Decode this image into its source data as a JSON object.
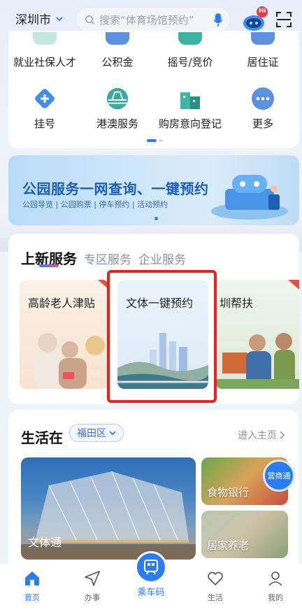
{
  "header": {
    "city": "深圳市",
    "search_placeholder": "搜索“体育场馆预约”",
    "robot_badge": "Hi"
  },
  "services": [
    {
      "label": "就业社保人才",
      "icon": "briefcase-icon"
    },
    {
      "label": "公积金",
      "icon": "fund-icon"
    },
    {
      "label": "摇号/竞价",
      "icon": "car-icon"
    },
    {
      "label": "居住证",
      "icon": "id-card-icon"
    },
    {
      "label": "挂号",
      "icon": "medical-cross-icon"
    },
    {
      "label": "港澳服务",
      "icon": "bridge-icon"
    },
    {
      "label": "购房意向登记",
      "icon": "building-icon"
    },
    {
      "label": "更多",
      "icon": "more-icon"
    }
  ],
  "banner": {
    "title": "公园服务一网查询、一键预约",
    "subtitle": "公园导览 | 公园购票 | 停车预约 | 活动预约"
  },
  "new_services": {
    "tabs": [
      "上新服务",
      "专区服务",
      "企业服务"
    ],
    "tiles": [
      "高龄老人津贴",
      "文体一键预约",
      "圳帮扶"
    ]
  },
  "life": {
    "title": "生活在",
    "district": "福田区",
    "home_link": "进入主页",
    "tiles": [
      "文体通",
      "食物银行",
      "居家养老"
    ],
    "badge": "营商通"
  },
  "nav": {
    "home": "首页",
    "work": "办事",
    "ride": "乘车码",
    "life": "生活",
    "mine": "我的"
  },
  "colors": {
    "accent": "#2c7cf6",
    "highlight_box": "#e8231c"
  }
}
